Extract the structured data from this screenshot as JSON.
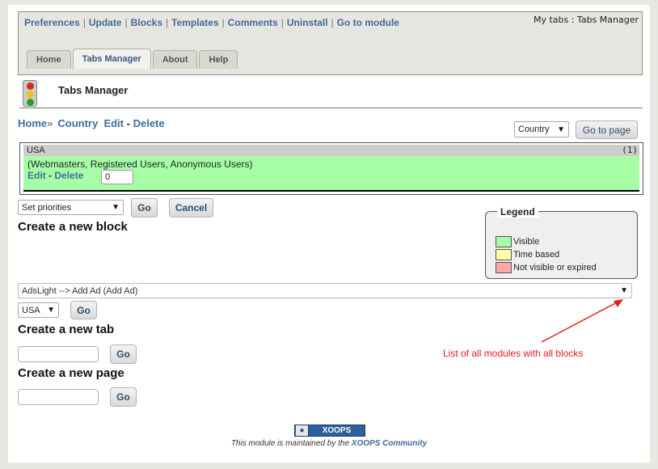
{
  "nav": {
    "links": [
      "Preferences",
      "Update",
      "Blocks",
      "Templates",
      "Comments",
      "Uninstall",
      "Go to module"
    ],
    "my_tabs": "My tabs : Tabs Manager"
  },
  "tabs": [
    {
      "label": "Home",
      "active": false
    },
    {
      "label": "Tabs Manager",
      "active": true
    },
    {
      "label": "About",
      "active": false
    },
    {
      "label": "Help",
      "active": false
    }
  ],
  "module": {
    "title": "Tabs Manager"
  },
  "breadcrumb": {
    "home": "Home",
    "separator": "»",
    "country": "Country",
    "edit": "Edit",
    "dash": "-",
    "delete": "Delete"
  },
  "page_select": {
    "value": "Country",
    "button": "Go to page"
  },
  "tab_box": {
    "name": "USA",
    "count": "(1)",
    "groups": "(Webmasters, Registered Users, Anonymous Users)",
    "edit": "Edit",
    "dash": "-",
    "delete": "Delete",
    "priority": "0"
  },
  "priorities": {
    "select": "Set priorities",
    "go": "Go",
    "cancel": "Cancel"
  },
  "sections": {
    "new_block": "Create a new block",
    "new_tab": "Create a new tab",
    "new_page": "Create a new page"
  },
  "legend": {
    "title": "Legend",
    "items": [
      {
        "label": "Visible",
        "color": "#a6ffa6"
      },
      {
        "label": "Time based",
        "color": "#ffffa6"
      },
      {
        "label": "Not visible or expired",
        "color": "#ffa6a6"
      }
    ]
  },
  "block_select": {
    "value": "AdsLight --> Add Ad (Add Ad)"
  },
  "tab_select": {
    "value": "USA",
    "go": "Go"
  },
  "new_tab": {
    "go": "Go"
  },
  "new_page": {
    "go": "Go"
  },
  "annotation": {
    "text": "List of all modules with all blocks",
    "color": "#e02020"
  },
  "footer": {
    "badge": "XOOPS",
    "note_prefix": "This module is maintained by the ",
    "note_link": "XOOPS Community"
  }
}
